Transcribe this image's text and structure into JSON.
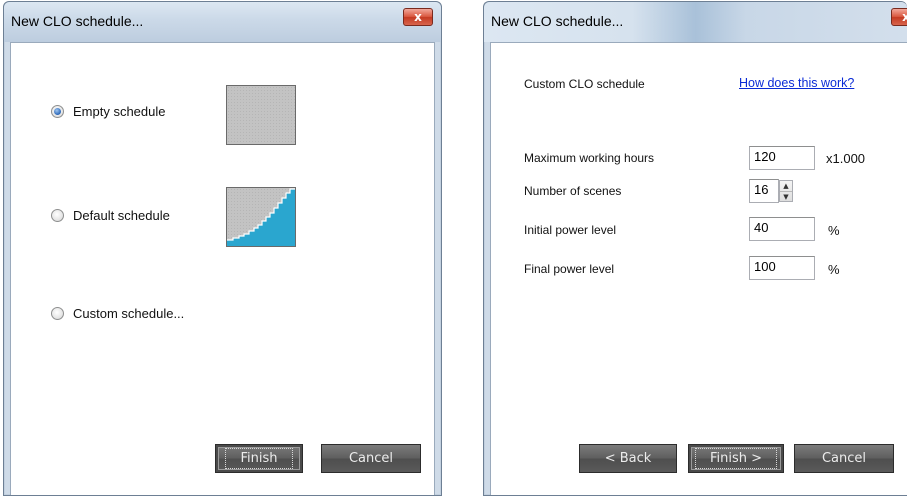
{
  "dialog1": {
    "title": "New CLO schedule...",
    "close_glyph": "x",
    "options": [
      {
        "label": "Empty schedule",
        "selected": true,
        "thumbnail": "empty-schedule-preview"
      },
      {
        "label": "Default schedule",
        "selected": false,
        "thumbnail": "default-schedule-curve-preview"
      },
      {
        "label": "Custom schedule...",
        "selected": false
      }
    ],
    "buttons": {
      "finish": "Finish",
      "cancel": "Cancel"
    }
  },
  "dialog2": {
    "title": "New CLO schedule...",
    "close_glyph": "x",
    "heading": "Custom CLO schedule",
    "help_link": "How does this work?",
    "fields": {
      "max_hours": {
        "label": "Maximum working hours",
        "value": "120",
        "unit": "x1.000"
      },
      "scenes": {
        "label": "Number of scenes",
        "value": "16"
      },
      "initial_power": {
        "label": "Initial power level",
        "value": "40",
        "unit": "%"
      },
      "final_power": {
        "label": "Final power level",
        "value": "100",
        "unit": "%"
      }
    },
    "buttons": {
      "back": "< Back",
      "finish": "Finish >",
      "cancel": "Cancel"
    }
  },
  "colors": {
    "accent_blue": "#2aa6cf",
    "link": "#0a2bd6",
    "button_dark": "#5e5e5e",
    "close_red": "#d9573f"
  }
}
